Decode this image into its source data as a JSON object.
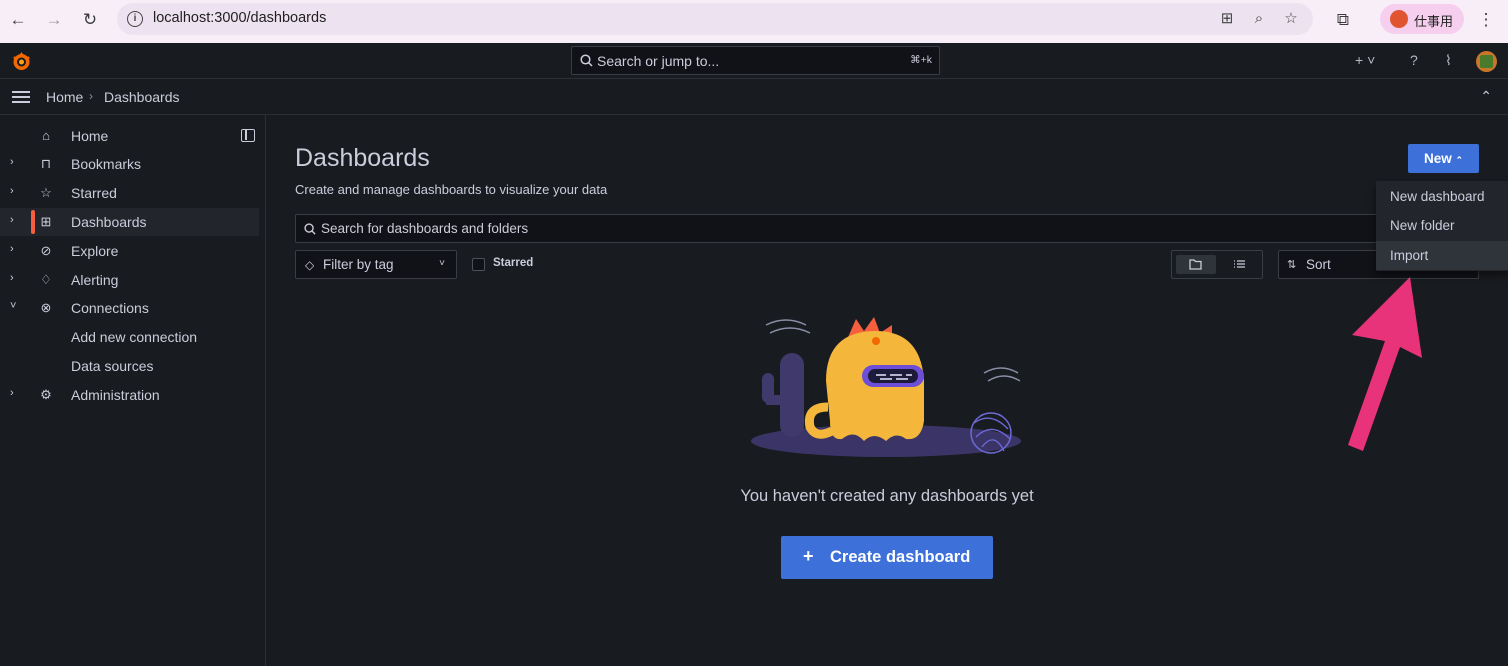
{
  "browser": {
    "url": "localhost:3000/dashboards",
    "profile_label": "仕事用"
  },
  "topbar": {
    "search_placeholder": "Search or jump to...",
    "search_shortcut": "⌘+k"
  },
  "breadcrumb": {
    "home": "Home",
    "separator": "›",
    "current": "Dashboards"
  },
  "sidebar": {
    "items": [
      {
        "label": "Home",
        "icon": "home-icon"
      },
      {
        "label": "Bookmarks",
        "icon": "bookmark-icon"
      },
      {
        "label": "Starred",
        "icon": "star-icon"
      },
      {
        "label": "Dashboards",
        "icon": "dashboards-icon",
        "active": true
      },
      {
        "label": "Explore",
        "icon": "compass-icon"
      },
      {
        "label": "Alerting",
        "icon": "bell-icon"
      },
      {
        "label": "Connections",
        "icon": "connections-icon",
        "expanded": true
      },
      {
        "label": "Add new connection"
      },
      {
        "label": "Data sources"
      },
      {
        "label": "Administration",
        "icon": "gear-icon"
      }
    ]
  },
  "main": {
    "title": "Dashboards",
    "subtitle": "Create and manage dashboards to visualize your data",
    "new_button": "New",
    "search_placeholder": "Search for dashboards and folders",
    "filter_tag_placeholder": "Filter by tag",
    "starred_label": "Starred",
    "sort_label": "Sort",
    "empty_text": "You haven't created any dashboards yet",
    "create_button": "Create dashboard"
  },
  "new_menu": {
    "items": [
      "New dashboard",
      "New folder",
      "Import"
    ],
    "highlighted": "Import"
  },
  "colors": {
    "accent": "#3d71d9",
    "active_indicator": "#f55f3e",
    "annotation_arrow": "#e8337a"
  }
}
